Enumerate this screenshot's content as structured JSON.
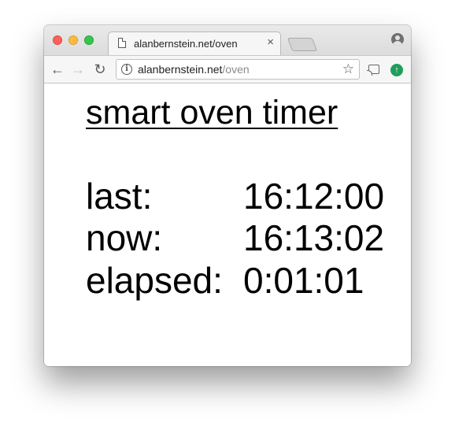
{
  "browser": {
    "tab": {
      "title": "alanbernstein.net/oven",
      "close_glyph": "×"
    },
    "toolbar": {
      "back_glyph": "←",
      "forward_glyph": "→",
      "reload_glyph": "↻"
    },
    "omnibox": {
      "info_glyph": "i",
      "url_host": "alanbernstein.net",
      "url_path": "/oven",
      "star_glyph": "☆"
    },
    "extension_glyph": "↑"
  },
  "page": {
    "heading": "smart oven timer",
    "rows": [
      {
        "label": "last:",
        "value": "16:12:00"
      },
      {
        "label": "now:",
        "value": "16:13:02"
      },
      {
        "label": "elapsed:",
        "value": "0:01:01"
      }
    ]
  },
  "colors": {
    "close": "#fc605c",
    "minimize": "#fdbc40",
    "maximize": "#34c84a",
    "extension": "#1e9e5a"
  }
}
